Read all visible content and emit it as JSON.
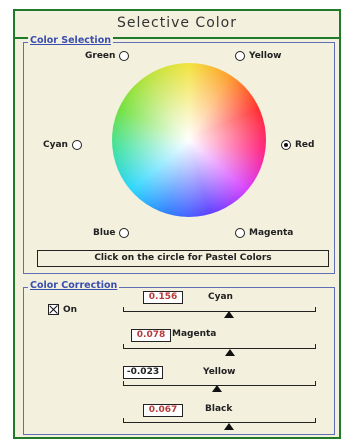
{
  "window": {
    "title": "Selective Color"
  },
  "color_selection": {
    "label": "Color Selection",
    "options": {
      "green": "Green",
      "yellow": "Yellow",
      "cyan": "Cyan",
      "red": "Red",
      "blue": "Blue",
      "magenta": "Magenta"
    },
    "selected": "Red",
    "pastel_button": "Click on the circle for Pastel Colors"
  },
  "color_correction": {
    "label": "Color Correction",
    "on_label": "On",
    "on_checked": true,
    "sliders": [
      {
        "name": "Cyan",
        "value": "0.156"
      },
      {
        "name": "Magenta",
        "value": "0.078"
      },
      {
        "name": "Yellow",
        "value": "-0.023"
      },
      {
        "name": "Black",
        "value": "0.067"
      }
    ]
  }
}
